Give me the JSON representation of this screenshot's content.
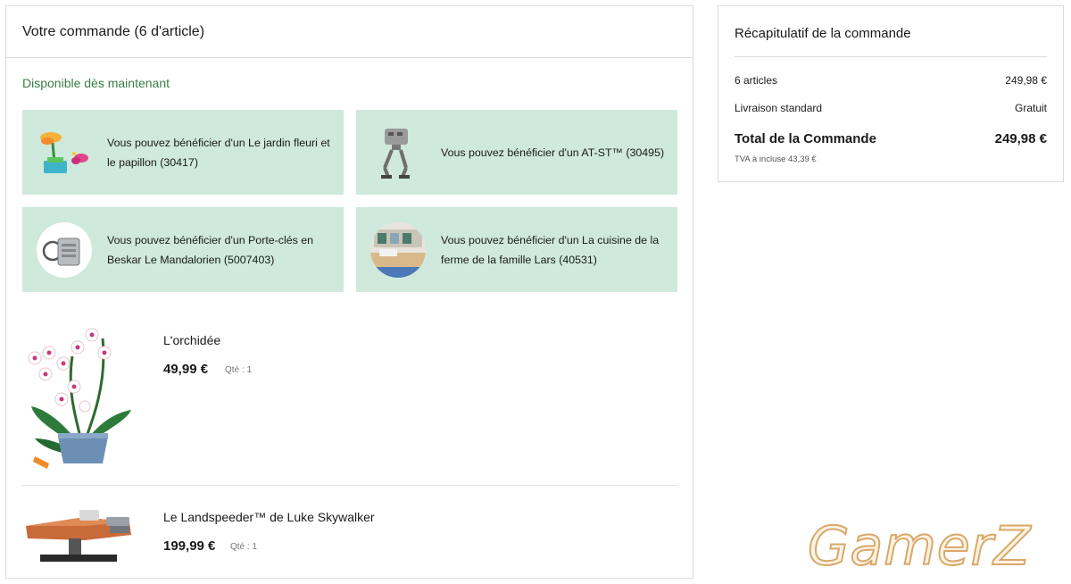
{
  "order": {
    "title": "Votre commande (6 d'article)",
    "availability": "Disponible dès maintenant",
    "gifts": [
      {
        "text": "Vous pouvez bénéficier d'un Le jardin fleuri et le papillon (30417)",
        "icon": "flower-garden-set-icon"
      },
      {
        "text": "Vous pouvez bénéficier d'un AT-ST™ (30495)",
        "icon": "at-st-walker-icon"
      },
      {
        "text": "Vous pouvez bénéficier d'un Porte-clés en Beskar Le Mandalorien (5007403)",
        "icon": "keychain-icon"
      },
      {
        "text": "Vous pouvez bénéficier d'un La cuisine de la ferme de la famille Lars (40531)",
        "icon": "kitchen-set-icon"
      }
    ],
    "products": [
      {
        "name": "L'orchidée",
        "price": "49,99 €",
        "qty": "Qté : 1",
        "icon": "orchid-image"
      },
      {
        "name": "Le Landspeeder™ de Luke Skywalker",
        "price": "199,99 €",
        "qty": "Qté : 1",
        "icon": "landspeeder-image"
      }
    ]
  },
  "summary": {
    "title": "Récapitulatif de la commande",
    "rows": [
      {
        "label": "6 articles",
        "value": "249,98 €"
      },
      {
        "label": "Livraison standard",
        "value": "Gratuit"
      }
    ],
    "total_label": "Total de la Commande",
    "total_value": "249,98 €",
    "vat": "TVA à incluse 43,39 €"
  },
  "watermark": "GamerZ",
  "colors": {
    "accent_green": "#3a7d44",
    "gift_bg": "#cfe9dc",
    "border": "#dcdcdc"
  }
}
